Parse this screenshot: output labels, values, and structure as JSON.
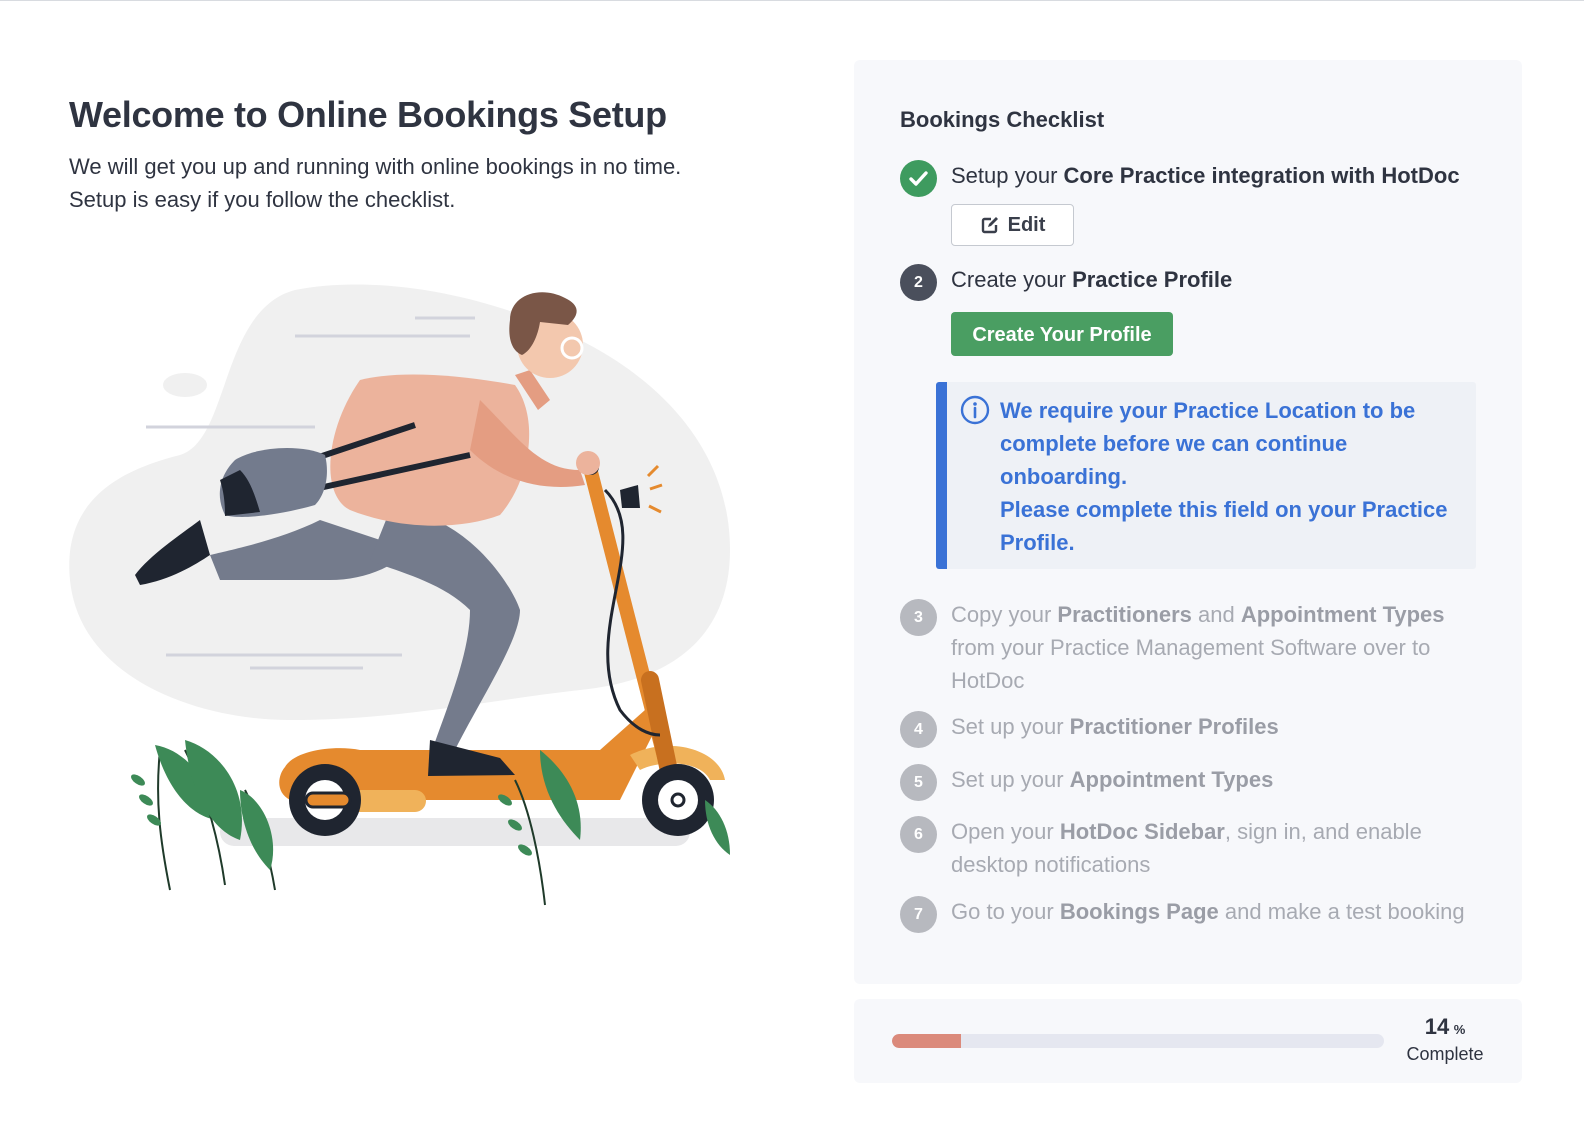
{
  "welcome": {
    "title": "Welcome to Online Bookings Setup",
    "subtitle_line1": "We will get you up and running with online bookings in no time.",
    "subtitle_line2": "Setup is easy if you follow the checklist."
  },
  "checklist": {
    "title": "Bookings Checklist",
    "steps": [
      {
        "number": "1",
        "status": "done",
        "prefix": "Setup your ",
        "bold": "Core Practice integration with HotDoc",
        "button_label": "Edit"
      },
      {
        "number": "2",
        "status": "active",
        "prefix": "Create your ",
        "bold": "Practice Profile",
        "button_label": "Create Your Profile"
      },
      {
        "number": "3",
        "status": "pending",
        "prefix": "Copy your ",
        "bold": "Practitioners",
        "middle": " and ",
        "bold2": "Appointment Types",
        "suffix": " from your Practice Management Software over to HotDoc"
      },
      {
        "number": "4",
        "status": "pending",
        "prefix": "Set up your ",
        "bold": "Practitioner Profiles"
      },
      {
        "number": "5",
        "status": "pending",
        "prefix": "Set up your ",
        "bold": "Appointment Types"
      },
      {
        "number": "6",
        "status": "pending",
        "prefix": "Open your ",
        "bold": "HotDoc Sidebar",
        "suffix": ", sign in, and enable desktop notifications"
      },
      {
        "number": "7",
        "status": "pending",
        "prefix": "Go to your ",
        "bold": "Bookings Page",
        "suffix": " and make a test booking"
      }
    ],
    "info": {
      "line1": "We require your Practice Location to be complete before we can continue onboarding.",
      "line2": "Please complete this field on your Practice Profile."
    }
  },
  "progress": {
    "value": "14",
    "percent": 14,
    "sign": "%",
    "label": "Complete"
  },
  "colors": {
    "done": "#3e9b5f",
    "active": "#4a4f5c",
    "pending": "#b7b9bf",
    "info": "#3a72d6",
    "progress": "#db8a7b"
  },
  "icons": [
    "check-icon",
    "edit-icon",
    "info-icon"
  ]
}
